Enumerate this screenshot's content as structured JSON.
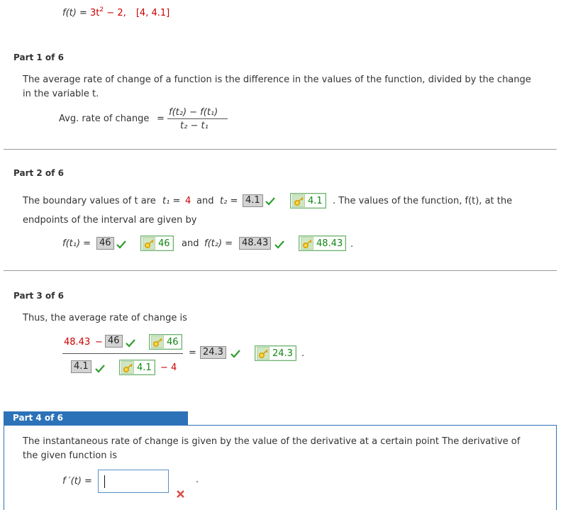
{
  "problem": {
    "fn_lhs": "f(t)",
    "eq": "=",
    "coef": "3t",
    "exp": "2",
    "minus": "−",
    "const": "2,",
    "interval": "[4, 4.1]"
  },
  "part1": {
    "title": "Part 1 of 6",
    "text1": "The average rate of change of a function is the difference in the values of the function, divided by the change",
    "text2": "in the variable t.",
    "avg_label": "Avg. rate of change",
    "eq": "=",
    "numerator": "f(t₂) − f(t₁)",
    "denominator": "t₂ − t₁"
  },
  "part2": {
    "title": "Part 2 of 6",
    "line1_a": "The boundary values of t are",
    "t1_label": "t₁ =",
    "t1_value": "4",
    "and": "and",
    "t2_label": "t₂ =",
    "t2_given": "4.1",
    "t2_answer": "4.1",
    "line1_b": ". The values of the function, f(t), at the",
    "line2": "endpoints of the interval are given by",
    "ft1_label": "f(t₁) =",
    "ft1_given": "46",
    "ft1_answer": "46",
    "and2": "and",
    "ft2_label": "f(t₂) =",
    "ft2_given": "48.43",
    "ft2_answer": "48.43",
    "period": "."
  },
  "part3": {
    "title": "Part 3 of 6",
    "text": "Thus, the average rate of change is",
    "num_a": "48.43",
    "num_minus": "−",
    "num_given": "46",
    "num_answer": "46",
    "den_given": "4.1",
    "den_answer": "4.1",
    "den_minus": "− 4",
    "eq": "=",
    "result_given": "24.3",
    "result_answer": "24.3",
    "period": "."
  },
  "part4": {
    "title": "Part 4 of 6",
    "text1": "The instantaneous rate of change is given by the value of the derivative at a certain point The derivative of",
    "text2": "the given function is",
    "deriv_label": "f ′(t) =",
    "input_value": "",
    "period": "."
  },
  "colors": {
    "accent_blue": "#2c72b8",
    "correct_green": "#118811",
    "value_red": "#cc0000",
    "wrong_red": "#d9534f"
  },
  "icons": [
    "check-icon",
    "key-icon",
    "wrong-x-icon"
  ]
}
